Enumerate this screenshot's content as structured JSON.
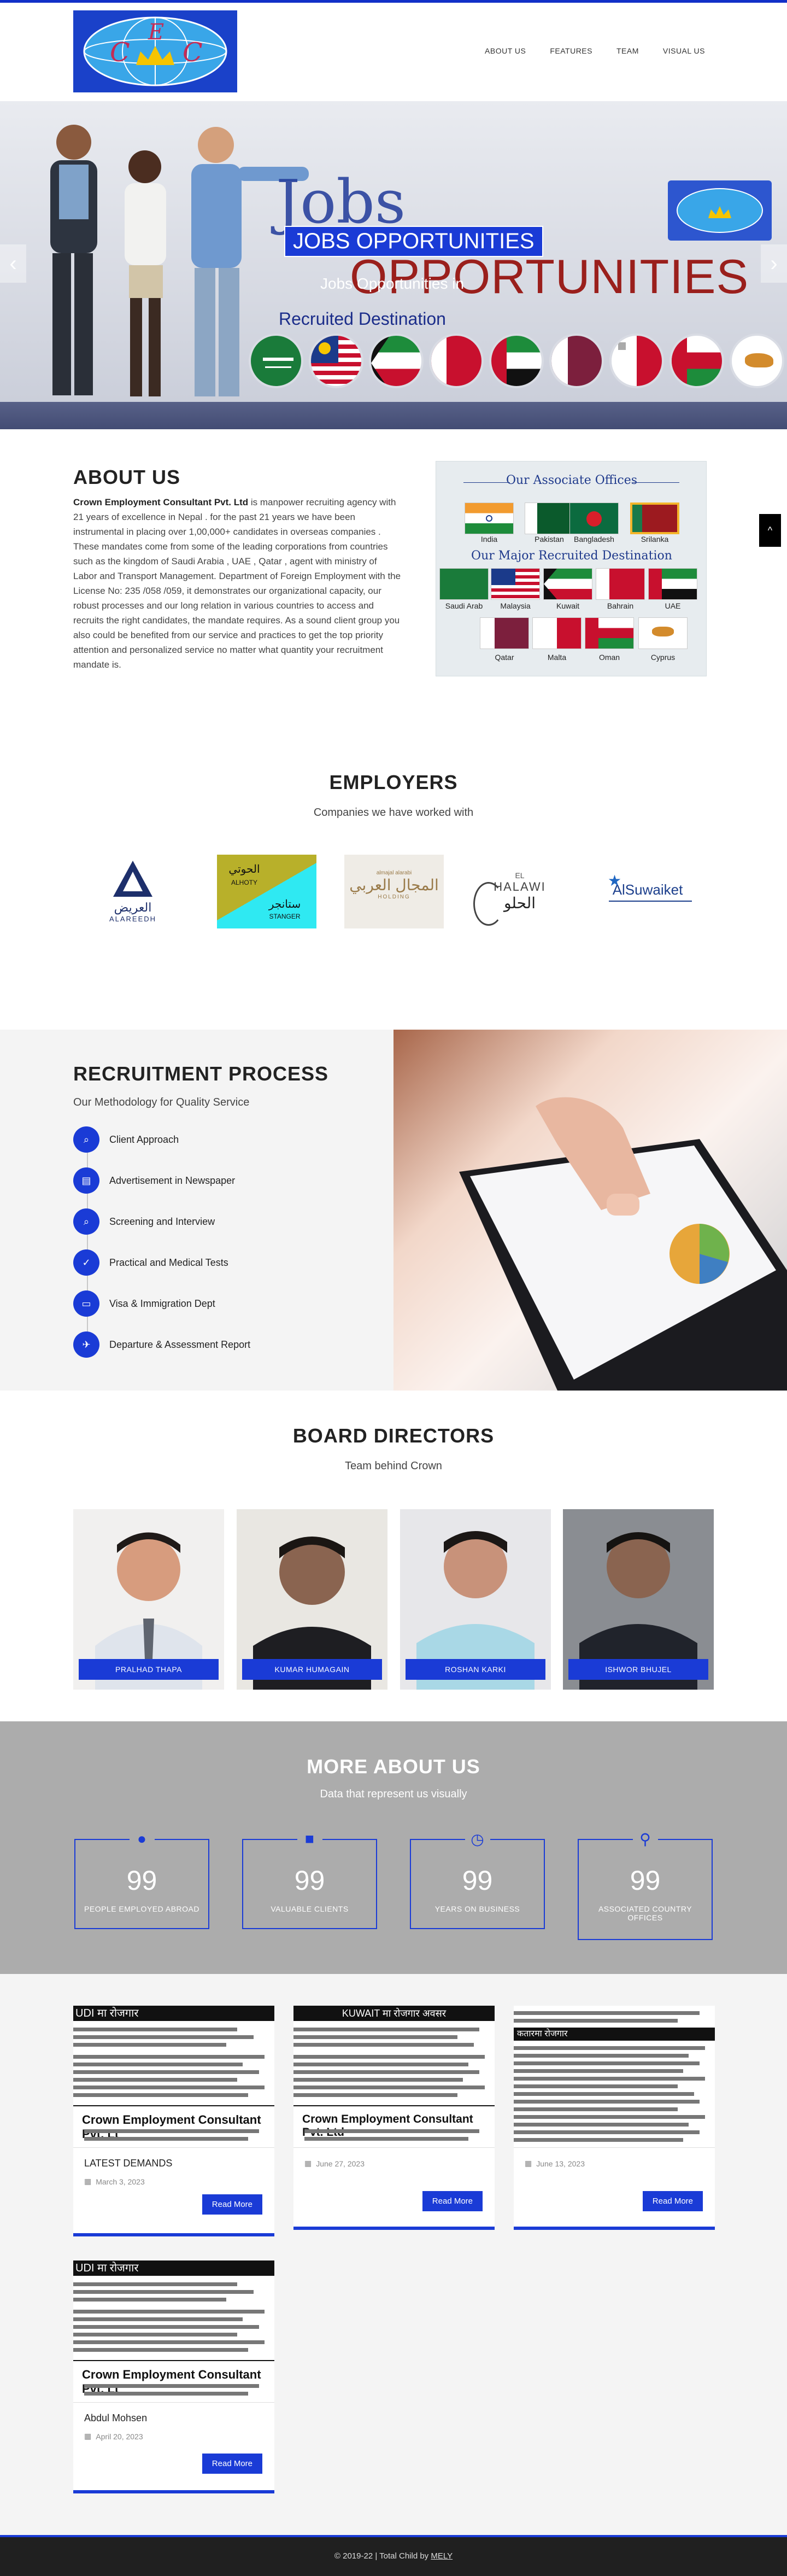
{
  "nav": [
    "ABOUT US",
    "FEATURES",
    "TEAM",
    "VISUAL US"
  ],
  "logo": {
    "letters": [
      "C",
      "E",
      "C"
    ]
  },
  "hero": {
    "word_jobs": "Jobs",
    "badge": "JOBS OPPORTUNITIES",
    "word_opportunities": "OPPORTUNITIES",
    "subtitle": "Jobs Opportunities in",
    "recruited": "Recruited Destination"
  },
  "about": {
    "title": "ABOUT US",
    "company": "Crown Employment Consultant Pvt. Ltd",
    "text": " is manpower recruiting agency with 21 years of excellence in Nepal . for the past 21 years we have been instrumental in placing over 1,00,000+ candidates in overseas companies . These mandates come from some of the leading corporations from countries such as the kingdom of Saudi Arabia , UAE , Qatar , agent with ministry of Labor and Transport Management. Department of Foreign Employment with the License No: 235 /058 /059, it demonstrates our organizational capacity, our robust processes and our long relation in various countries to access and recruits the right candidates, the mandate requires. As a sound client group you also could be benefited from our service and practices to get the top priority attention and personalized service no matter what quantity your recruitment mandate is.",
    "assoc_title": "Our Associate Offices",
    "assoc_offices": [
      "India",
      "Pakistan",
      "Bangladesh",
      "Srilanka"
    ],
    "major_title": "Our Major Recruited Destination",
    "major_row1": [
      "Saudi Arab",
      "Malaysia",
      "Kuwait",
      "Bahrain",
      "UAE"
    ],
    "major_row2": [
      "Qatar",
      "Malta",
      "Oman",
      "Cyprus"
    ]
  },
  "employers": {
    "title": "EMPLOYERS",
    "subtitle": "Companies we have worked with",
    "logos": [
      {
        "name": "ALAREEDH",
        "arabic": "العريض"
      },
      {
        "name": "ALHOTY",
        "arabic": "الحوتي",
        "name2": "STANGER",
        "arabic2": "ستانجر"
      },
      {
        "name": "HOLDING",
        "arabic": "المجال العربي",
        "small": "almajal alarabi"
      },
      {
        "name": "HALAWI",
        "arabic": "الحلو",
        "prefix": "EL"
      },
      {
        "name": "AlSuwaiket"
      }
    ]
  },
  "recruitment": {
    "title": "RECRUITMENT PROCESS",
    "subtitle": "Our Methodology for Quality Service",
    "steps": [
      "Client Approach",
      "Advertisement in Newspaper",
      "Screening and Interview",
      "Practical and Medical Tests",
      "Visa & Immigration Dept",
      "Departure & Assessment Report"
    ]
  },
  "board": {
    "title": "BOARD DIRECTORS",
    "subtitle": "Team behind Crown",
    "members": [
      "PRALHAD THAPA",
      "KUMAR HUMAGAIN",
      "ROSHAN KARKI",
      "ISHWOR BHUJEL"
    ]
  },
  "more": {
    "title": "MORE ABOUT US",
    "subtitle": "Data that represent us visually",
    "counters": [
      {
        "value": "99",
        "label": "PEOPLE EMPLOYED ABROAD",
        "icon": "user-icon"
      },
      {
        "value": "99",
        "label": "VALUABLE CLIENTS",
        "icon": "briefcase-icon"
      },
      {
        "value": "99",
        "label": "YEARS ON BUSINESS",
        "icon": "clock-icon"
      },
      {
        "value": "99",
        "label": "ASSOCIATED COUNTRY OFFICES",
        "icon": "pin-icon"
      }
    ]
  },
  "news": [
    {
      "title": "LATEST DEMANDS",
      "date": "March 3, 2023",
      "button": "Read More",
      "np_head": "UDI मा रोजगार",
      "np_company": "Crown Employment Consultant Pvt. Lt"
    },
    {
      "title": "",
      "date": "June 27, 2023",
      "button": "Read More",
      "np_head": "KUWAIT मा रोजगार अवसर",
      "np_company": "Crown Employment Consultant Pvt. Ltd"
    },
    {
      "title": "",
      "date": "June 13, 2023",
      "button": "Read More",
      "np_head": "कतारमा रोजगार",
      "np_company": ""
    },
    {
      "title": "Abdul Mohsen",
      "date": "April 20, 2023",
      "button": "Read More",
      "np_head": "UDI मा रोजगार",
      "np_company": "Crown Employment Consultant Pvt. Lt"
    }
  ],
  "footer": {
    "text": "© 2019-22 | Total Child by",
    "brand": "MELY"
  },
  "colors": {
    "accent": "#1a3bd6",
    "footer": "#202020",
    "more_bg": "#acacac"
  }
}
